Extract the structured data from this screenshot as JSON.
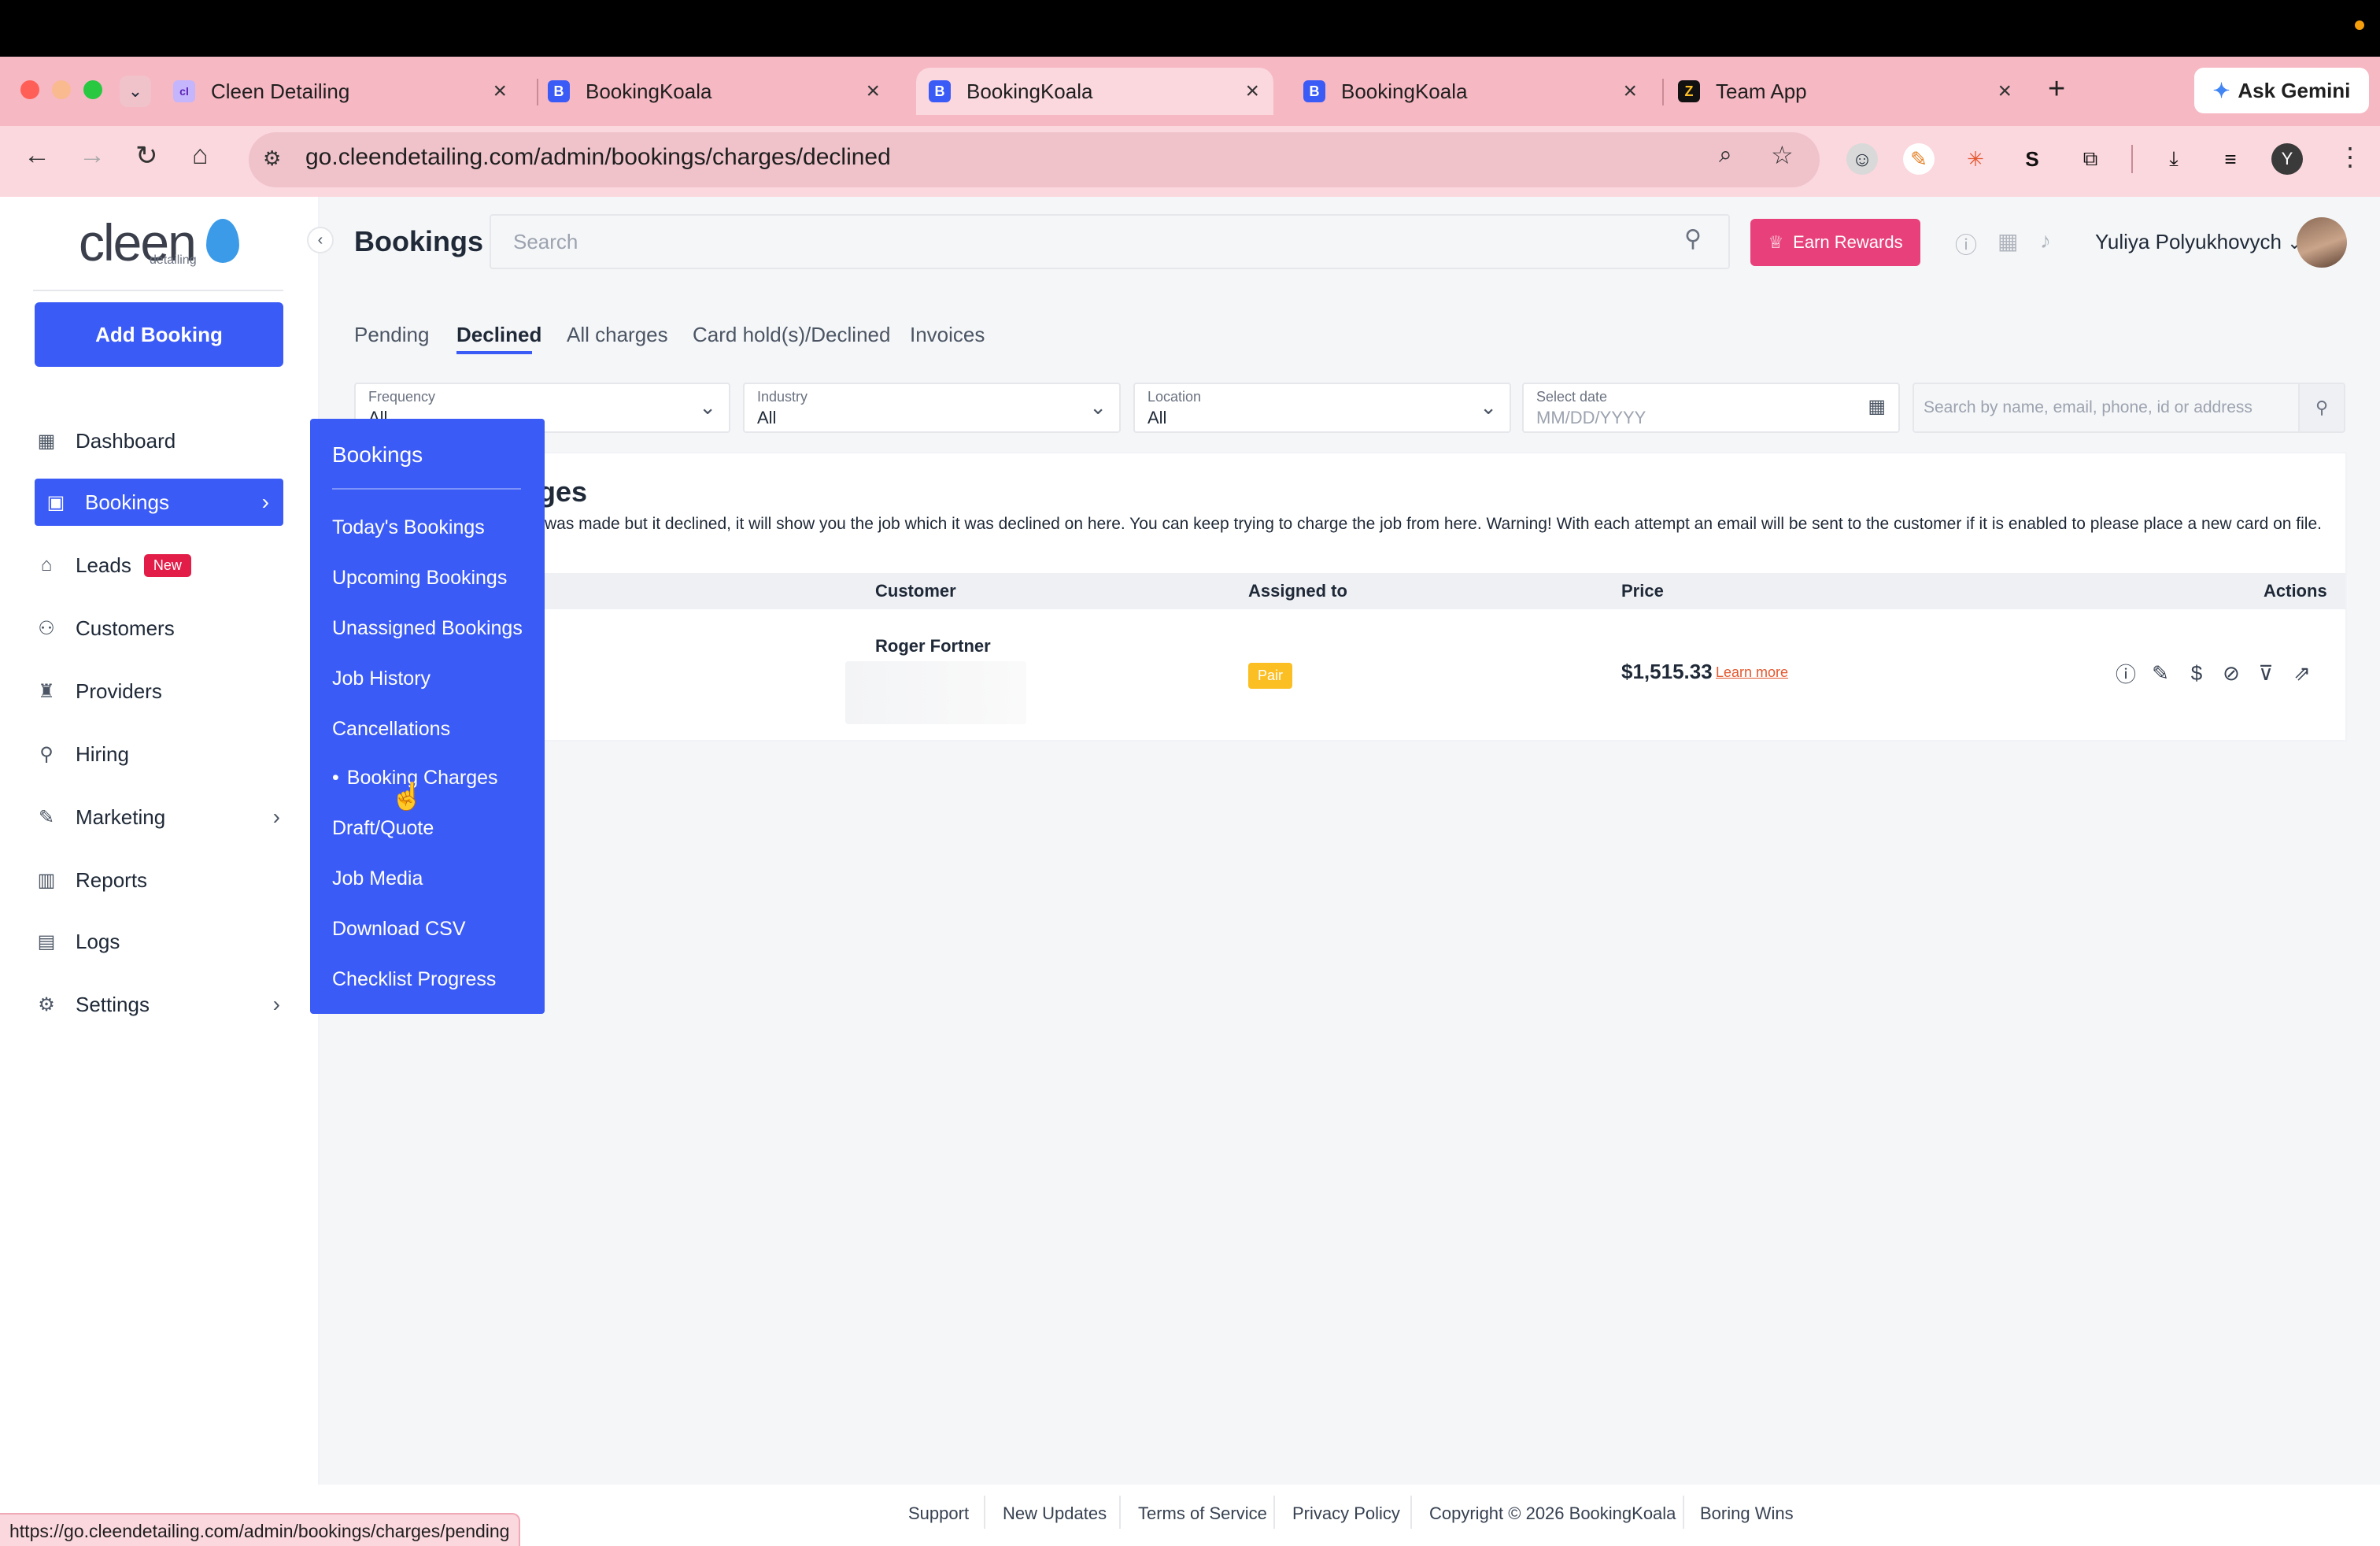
{
  "browser": {
    "tabs": [
      {
        "title": "Cleen Detailing",
        "favicon": "cleen-icon"
      },
      {
        "title": "BookingKoala",
        "favicon": "bookingkoala-icon"
      },
      {
        "title": "BookingKoala",
        "favicon": "bookingkoala-icon"
      },
      {
        "title": "BookingKoala",
        "favicon": "bookingkoala-icon"
      },
      {
        "title": "Team App",
        "favicon": "z-icon"
      }
    ],
    "ask_gemini": "Ask Gemini",
    "url": "go.cleendetailing.com/admin/bookings/charges/declined",
    "status_url": "https://go.cleendetailing.com/admin/bookings/charges/pending",
    "profile_initial": "Y"
  },
  "sidebar": {
    "logo_text": "cleen",
    "logo_sub": "detailing",
    "add_booking": "Add Booking",
    "items": [
      {
        "label": "Dashboard",
        "icon": "dashboard-icon"
      },
      {
        "label": "Bookings",
        "icon": "calendar-icon"
      },
      {
        "label": "Leads",
        "icon": "leads-icon",
        "badge": "New"
      },
      {
        "label": "Customers",
        "icon": "customers-icon"
      },
      {
        "label": "Providers",
        "icon": "providers-icon"
      },
      {
        "label": "Hiring",
        "icon": "hiring-icon"
      },
      {
        "label": "Marketing",
        "icon": "marketing-icon"
      },
      {
        "label": "Reports",
        "icon": "reports-icon"
      },
      {
        "label": "Logs",
        "icon": "logs-icon"
      },
      {
        "label": "Settings",
        "icon": "gear-icon"
      }
    ]
  },
  "flyout": {
    "title": "Bookings",
    "items": [
      "Today's Bookings",
      "Upcoming Bookings",
      "Unassigned Bookings",
      "Job History",
      "Cancellations",
      "Booking Charges",
      "Draft/Quote",
      "Job Media",
      "Download CSV",
      "Checklist Progress"
    ],
    "current": "Booking Charges"
  },
  "header": {
    "title": "Bookings",
    "search_placeholder": "Search",
    "earn_rewards": "Earn Rewards",
    "user_name": "Yuliya Polyukhovych"
  },
  "tabs": [
    "Pending",
    "Declined",
    "All charges",
    "Card hold(s)/Declined",
    "Invoices"
  ],
  "active_tab": "Declined",
  "filters": {
    "frequency": {
      "label": "Frequency",
      "value": "All"
    },
    "industry": {
      "label": "Industry",
      "value": "All"
    },
    "location": {
      "label": "Location",
      "value": "All"
    },
    "date": {
      "label": "Select date",
      "placeholder": "MM/DD/YYYY"
    },
    "search_placeholder": "Search by name, email, phone, id or address"
  },
  "section": {
    "title_visible": "rges",
    "description_visible": "was made but it declined, it will show you the job which it was declined on here. You can keep trying to charge the job from here. Warning! With each attempt an email will be sent to the customer if it is enabled to please place a new card on file."
  },
  "table": {
    "headers": [
      "Customer",
      "Assigned to",
      "Price",
      "Actions"
    ],
    "rows": [
      {
        "customer": "Roger Fortner",
        "assigned": "Pair",
        "price": "$1,515.33",
        "learn_more": "Learn more"
      }
    ]
  },
  "footer": [
    "Support",
    "New Updates",
    "Terms of Service",
    "Privacy Policy",
    "Copyright © 2026 BookingKoala",
    "Boring Wins"
  ],
  "colors": {
    "primary": "#3b5bf6",
    "rewards": "#e8407a",
    "badge": "#fbbf24",
    "tabstrip": "#f6b8c3"
  }
}
